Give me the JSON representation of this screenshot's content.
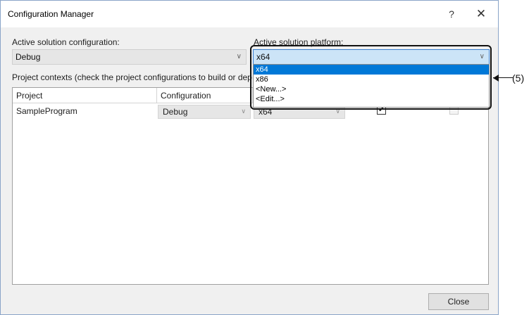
{
  "window": {
    "title": "Configuration Manager",
    "help_glyph": "?",
    "close_glyph": "✕"
  },
  "solution_config": {
    "label": "Active solution configuration:",
    "value": "Debug"
  },
  "solution_platform": {
    "label": "Active solution platform:",
    "value": "x64",
    "options": [
      "x64",
      "x86",
      "<New...>",
      "<Edit...>"
    ],
    "selected_option": "x64"
  },
  "project_contexts": {
    "label": "Project contexts (check the project configurations to build or dep"
  },
  "grid": {
    "columns": [
      "Project",
      "Configuration"
    ],
    "rows": [
      {
        "project": "SampleProgram",
        "configuration": "Debug",
        "platform": "x64",
        "build_checked": "✔",
        "deploy_checked": ""
      }
    ]
  },
  "annotation": {
    "label": "(5)"
  },
  "buttons": {
    "close": "Close"
  },
  "icons": {
    "dropdown": "chevron-down-icon",
    "arrow": "arrow-left-icon"
  },
  "colors": {
    "selection": "#0078d7",
    "active_combo": "#cce4f7"
  }
}
